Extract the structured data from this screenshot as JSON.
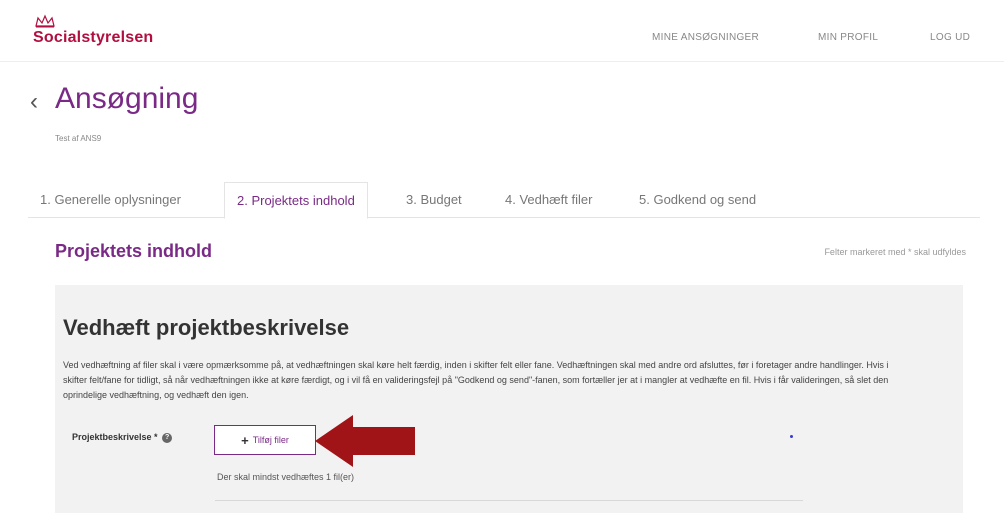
{
  "header": {
    "brand": "Socialstyrelsen",
    "nav": [
      {
        "id": "mine-ansogninger",
        "label": "MINE ANSØGNINGER"
      },
      {
        "id": "min-profil",
        "label": "MIN PROFIL"
      },
      {
        "id": "log-ud",
        "label": "LOG UD"
      }
    ]
  },
  "page": {
    "back": "‹",
    "title": "Ansøgning",
    "subtitle": "Test af ANS9"
  },
  "tabs": [
    {
      "label": "1. Generelle oplysninger",
      "active": false
    },
    {
      "label": "2. Projektets indhold",
      "active": true
    },
    {
      "label": "3. Budget",
      "active": false
    },
    {
      "label": "4. Vedhæft filer",
      "active": false
    },
    {
      "label": "5. Godkend og send",
      "active": false
    }
  ],
  "section": {
    "title": "Projektets indhold",
    "required_note": "Felter markeret med * skal udfyldes"
  },
  "panel": {
    "title": "Vedhæft projektbeskrivelse",
    "text": "Ved vedhæftning af filer skal i være opmærksomme på, at vedhæftningen skal køre helt færdig, inden i skifter felt eller fane. Vedhæftningen skal med andre ord afsluttes, før i foretager andre handlinger. Hvis i skifter felt/fane for tidligt, så når vedhæftningen ikke at køre færdigt, og i vil få en valideringsfejl på \"Godkend og send\"-fanen, som fortæller jer at i mangler at vedhæfte en fil. Hvis i får valideringen, så slet den oprindelige vedhæftning, og vedhæft den igen.",
    "field_label": "Projektbeskrivelse *",
    "help": "?",
    "add_button": "Tilføj filer",
    "plus": "+",
    "min_note": "Der skal mindst vedhæftes 1 fil(er)"
  },
  "colors": {
    "brand_red": "#b10f3f",
    "accent_purple": "#7a2a86",
    "annotation_arrow": "#a01418"
  }
}
